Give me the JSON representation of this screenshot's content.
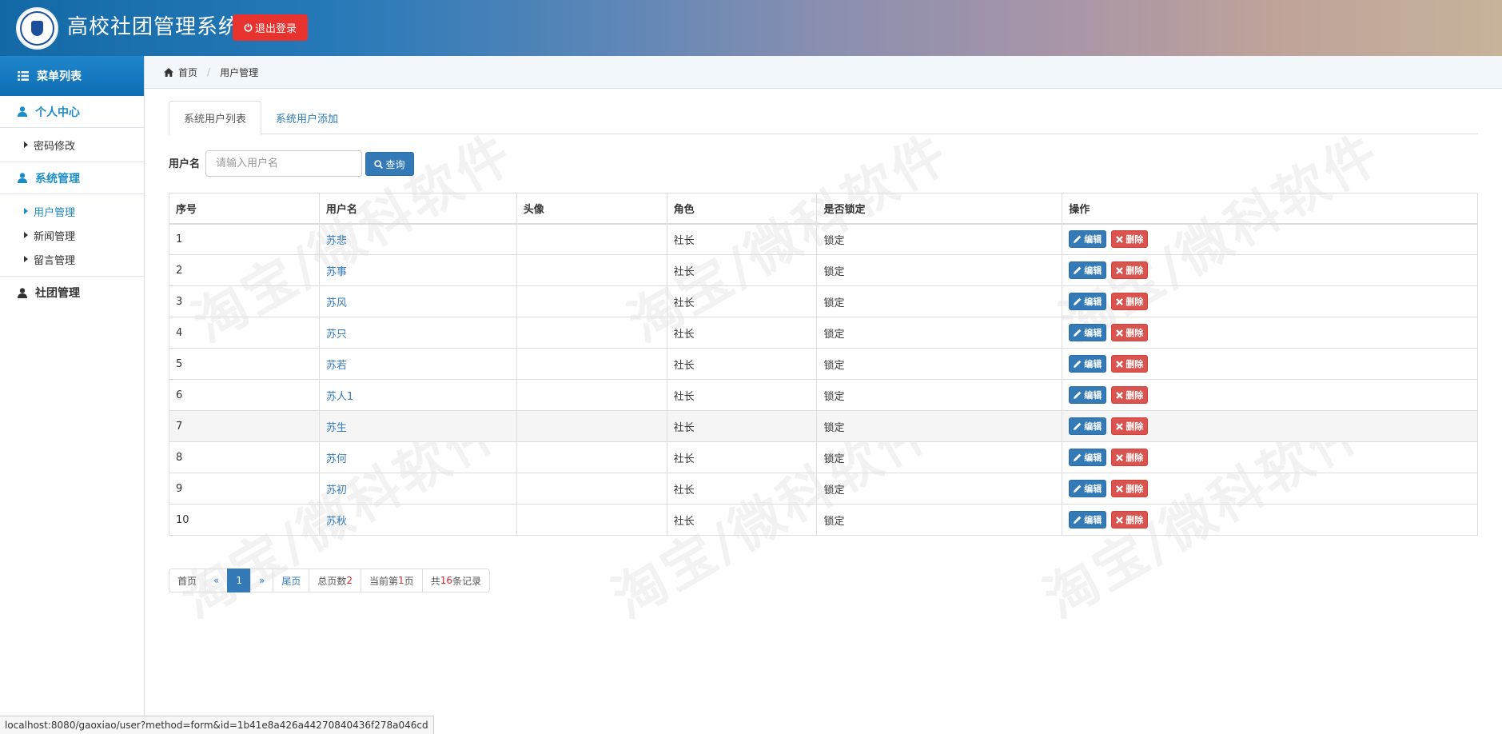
{
  "header": {
    "title": "高校社团管理系统",
    "logout_label": "退出登录"
  },
  "sidebar": {
    "menu_title": "菜单列表",
    "groups": [
      {
        "label": "个人中心",
        "items": [
          {
            "label": "密码修改"
          }
        ]
      },
      {
        "label": "系统管理",
        "items": [
          {
            "label": "用户管理"
          },
          {
            "label": "新闻管理"
          },
          {
            "label": "留言管理"
          }
        ]
      },
      {
        "label": "社团管理",
        "items": []
      }
    ]
  },
  "breadcrumb": {
    "home": "首页",
    "current": "用户管理"
  },
  "tabs": [
    {
      "label": "系统用户列表"
    },
    {
      "label": "系统用户添加"
    }
  ],
  "search": {
    "label": "用户名",
    "placeholder": "请输入用户名",
    "button": "查询"
  },
  "table": {
    "headers": [
      "序号",
      "用户名",
      "头像",
      "角色",
      "是否锁定",
      "操作"
    ],
    "edit_label": "编辑",
    "delete_label": "删除",
    "rows": [
      {
        "no": "1",
        "username": "苏悲",
        "avatar": "",
        "role": "社长",
        "locked": "锁定"
      },
      {
        "no": "2",
        "username": "苏事",
        "avatar": "",
        "role": "社长",
        "locked": "锁定"
      },
      {
        "no": "3",
        "username": "苏风",
        "avatar": "",
        "role": "社长",
        "locked": "锁定"
      },
      {
        "no": "4",
        "username": "苏只",
        "avatar": "",
        "role": "社长",
        "locked": "锁定"
      },
      {
        "no": "5",
        "username": "苏若",
        "avatar": "",
        "role": "社长",
        "locked": "锁定"
      },
      {
        "no": "6",
        "username": "苏人1",
        "avatar": "",
        "role": "社长",
        "locked": "锁定"
      },
      {
        "no": "7",
        "username": "苏生",
        "avatar": "",
        "role": "社长",
        "locked": "锁定"
      },
      {
        "no": "8",
        "username": "苏何",
        "avatar": "",
        "role": "社长",
        "locked": "锁定"
      },
      {
        "no": "9",
        "username": "苏初",
        "avatar": "",
        "role": "社长",
        "locked": "锁定"
      },
      {
        "no": "10",
        "username": "苏秋",
        "avatar": "",
        "role": "社长",
        "locked": "锁定"
      }
    ]
  },
  "pagination": {
    "first": "首页",
    "prev": "«",
    "current": "1",
    "next": "»",
    "last": "尾页",
    "total_pages_prefix": "总页数",
    "total_pages": "2",
    "current_page_prefix": "当前第",
    "current_page": "1",
    "current_page_suffix": "页",
    "records_prefix": "共",
    "records": "16",
    "records_suffix": "条记录"
  },
  "statusbar": {
    "url": "localhost:8080/gaoxiao/user?method=form&id=1b41e8a426a44270840436f278a046cd"
  },
  "watermark": {
    "text": "淘宝/微科软件"
  },
  "colors": {
    "primary": "#337ab7",
    "danger": "#d9534f",
    "logout": "#e8322e",
    "accent": "#1c8dc6"
  }
}
